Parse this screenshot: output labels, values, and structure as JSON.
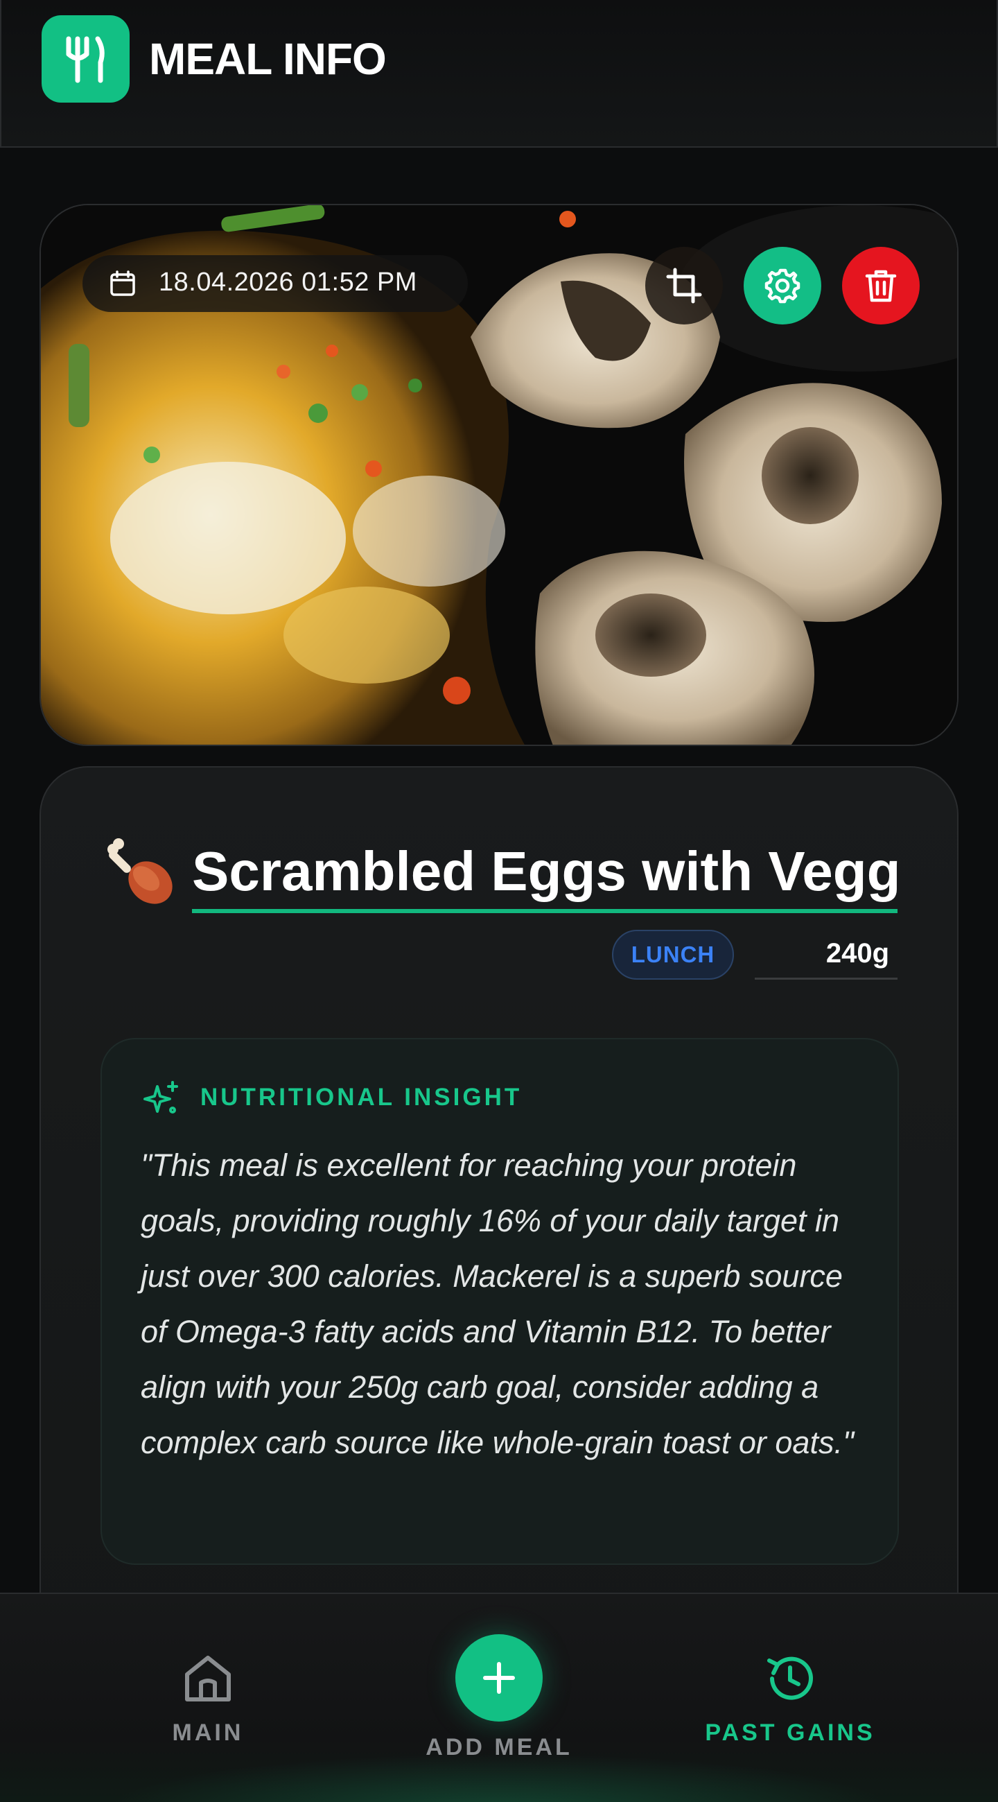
{
  "header": {
    "app_title": "MEAL INFO",
    "logo_icon": "fork-knife-icon"
  },
  "photo": {
    "date": "18.04.2026 01:52 PM",
    "date_icon": "calendar-icon",
    "actions": [
      {
        "name": "crop",
        "icon": "crop-icon"
      },
      {
        "name": "settings",
        "icon": "gear-icon",
        "color": "#13be86"
      },
      {
        "name": "delete",
        "icon": "trash-icon",
        "color": "#e5151f"
      }
    ]
  },
  "meal": {
    "emoji": "poultry-leg-icon",
    "name": "Scrambled Eggs with Veggi",
    "type": "LUNCH",
    "weight": "240g"
  },
  "insight": {
    "title": "NUTRITIONAL INSIGHT",
    "icon": "sparkles-icon",
    "text": "\"This meal is excellent for reaching your protein goals, providing roughly 16% of your daily target in just over 300 calories. Mackerel is a superb source of Omega-3 fatty acids and Vitamin B12. To better align with your 250g carb goal, consider adding a complex carb source like whole-grain toast or oats.\""
  },
  "nav": {
    "items": [
      {
        "label": "MAIN",
        "icon": "home-icon",
        "color": "#8a8d90"
      },
      {
        "label": "ADD MEAL",
        "icon": "plus-icon",
        "color": "#8a8d90"
      },
      {
        "label": "PAST GAINS",
        "icon": "history-icon",
        "color": "#18c78b",
        "active": true
      }
    ]
  },
  "colors": {
    "accent": "#12c084",
    "danger": "#e5151f",
    "badge_blue": "#3b82f6",
    "background": "#0c0d0e"
  }
}
